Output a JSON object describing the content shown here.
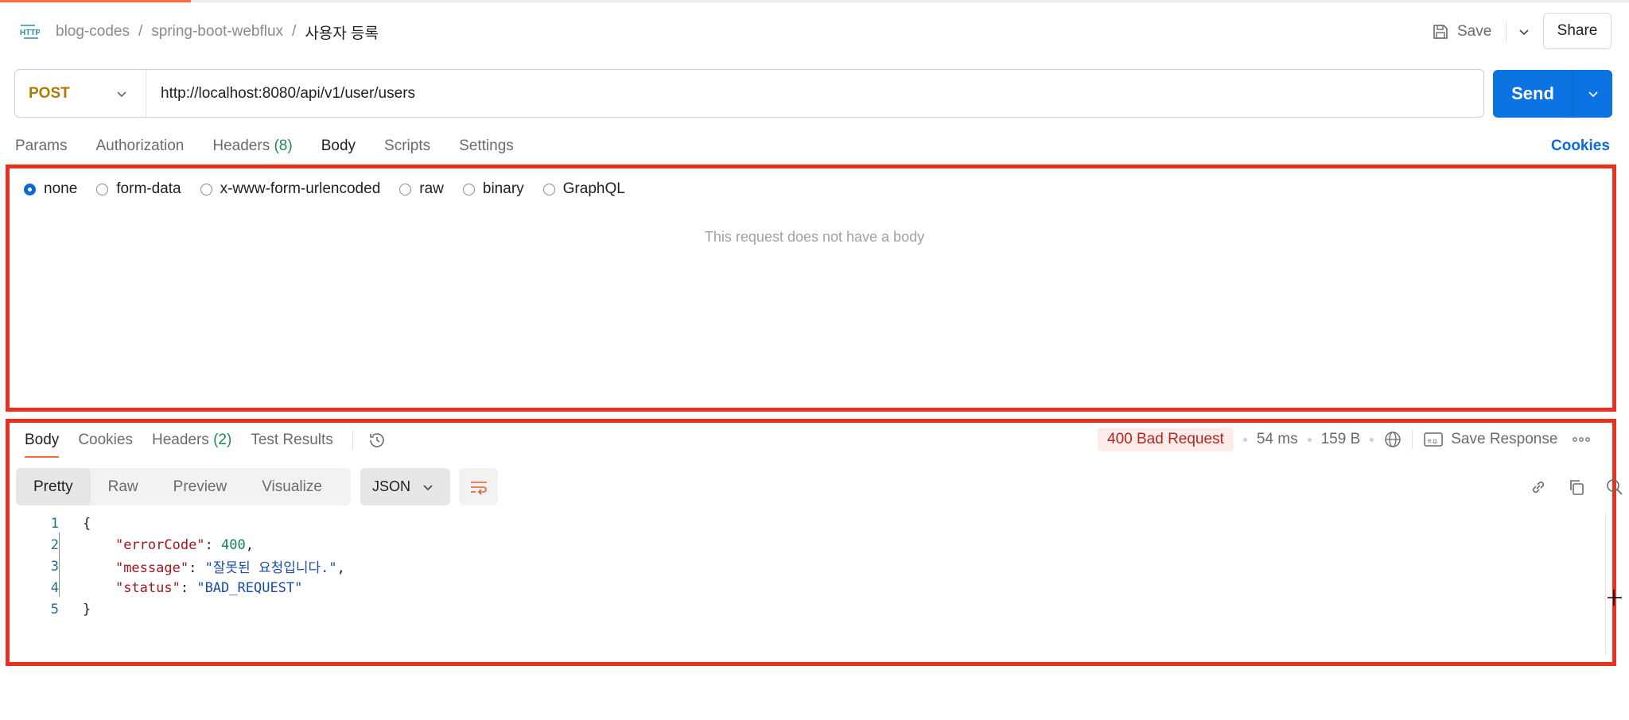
{
  "breadcrumb": {
    "items": [
      "blog-codes",
      "spring-boot-webflux"
    ],
    "current": "사용자 등록",
    "icon": "http-icon"
  },
  "header": {
    "save_label": "Save",
    "share_label": "Share"
  },
  "request": {
    "method": "POST",
    "url": "http://localhost:8080/api/v1/user/users",
    "send_label": "Send",
    "tabs": [
      {
        "label": "Params"
      },
      {
        "label": "Authorization"
      },
      {
        "label": "Headers",
        "count": "(8)"
      },
      {
        "label": "Body"
      },
      {
        "label": "Scripts"
      },
      {
        "label": "Settings"
      }
    ],
    "active_tab": "Body",
    "cookies_label": "Cookies"
  },
  "body_types": {
    "options": [
      "none",
      "form-data",
      "x-www-form-urlencoded",
      "raw",
      "binary",
      "GraphQL"
    ],
    "selected": "none",
    "empty_message": "This request does not have a body"
  },
  "response": {
    "tabs": [
      {
        "label": "Body"
      },
      {
        "label": "Cookies"
      },
      {
        "label": "Headers",
        "count": "(2)"
      },
      {
        "label": "Test Results"
      }
    ],
    "active_tab": "Body",
    "status": "400 Bad Request",
    "time": "54 ms",
    "size": "159 B",
    "save_response_label": "Save Response",
    "view_modes": [
      "Pretty",
      "Raw",
      "Preview",
      "Visualize"
    ],
    "active_view": "Pretty",
    "format": "JSON",
    "code_lines": [
      {
        "n": "1",
        "parts": [
          {
            "t": "p",
            "v": "{"
          }
        ]
      },
      {
        "n": "2",
        "parts": [
          {
            "t": "p",
            "v": "    "
          },
          {
            "t": "k",
            "v": "\"errorCode\""
          },
          {
            "t": "p",
            "v": ": "
          },
          {
            "t": "n",
            "v": "400"
          },
          {
            "t": "p",
            "v": ","
          }
        ]
      },
      {
        "n": "3",
        "parts": [
          {
            "t": "p",
            "v": "    "
          },
          {
            "t": "k",
            "v": "\"message\""
          },
          {
            "t": "p",
            "v": ": "
          },
          {
            "t": "s",
            "v": "\"잘못된 요청입니다.\""
          },
          {
            "t": "p",
            "v": ","
          }
        ]
      },
      {
        "n": "4",
        "parts": [
          {
            "t": "p",
            "v": "    "
          },
          {
            "t": "k",
            "v": "\"status\""
          },
          {
            "t": "p",
            "v": ": "
          },
          {
            "t": "s",
            "v": "\"BAD_REQUEST\""
          }
        ]
      },
      {
        "n": "5",
        "parts": [
          {
            "t": "p",
            "v": "}"
          }
        ]
      }
    ]
  },
  "colors": {
    "accent": "#ff6c37",
    "send": "#0b72e1",
    "highlight": "#e8321e",
    "method_post": "#ad7a03",
    "status_error": "#b3261e"
  }
}
